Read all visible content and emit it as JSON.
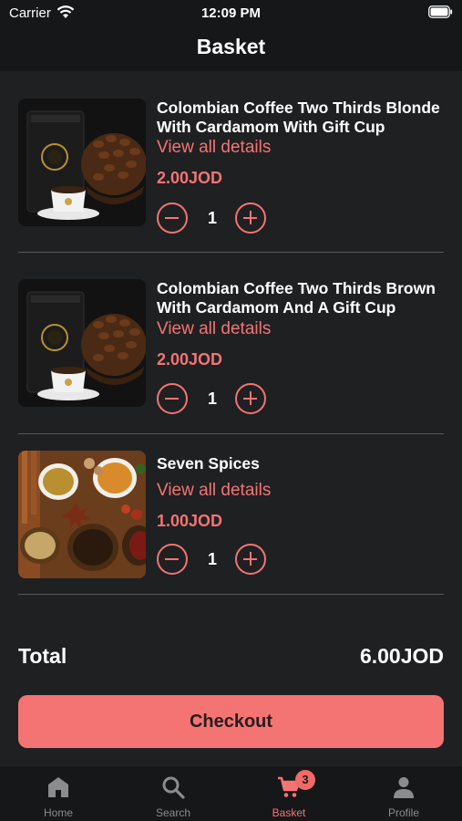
{
  "status_bar": {
    "carrier": "Carrier",
    "time": "12:09 PM"
  },
  "header": {
    "title": "Basket"
  },
  "basket": {
    "items": [
      {
        "title": "Colombian Coffee Two Thirds Blonde With Cardamom With Gift Cup",
        "details_link": "View all details",
        "price": "2.00JOD",
        "quantity": "1"
      },
      {
        "title": "Colombian Coffee Two Thirds Brown With Cardamom And A Gift Cup",
        "details_link": "View all details",
        "price": "2.00JOD",
        "quantity": "1"
      },
      {
        "title": "Seven Spices",
        "details_link": "View all details",
        "price": "1.00JOD",
        "quantity": "1"
      }
    ],
    "total_label": "Total",
    "total_value": "6.00JOD",
    "checkout_label": "Checkout"
  },
  "tab_bar": {
    "tabs": [
      {
        "label": "Home",
        "icon": "home-icon"
      },
      {
        "label": "Search",
        "icon": "search-icon"
      },
      {
        "label": "Basket",
        "icon": "cart-icon",
        "badge": "3"
      },
      {
        "label": "Profile",
        "icon": "profile-icon"
      }
    ],
    "active_tab": "Basket"
  },
  "colors": {
    "accent": "#f47473",
    "background": "#1f2022",
    "bar_background": "#161719",
    "divider": "#55585c",
    "inactive_tab": "#8c8c8c"
  }
}
